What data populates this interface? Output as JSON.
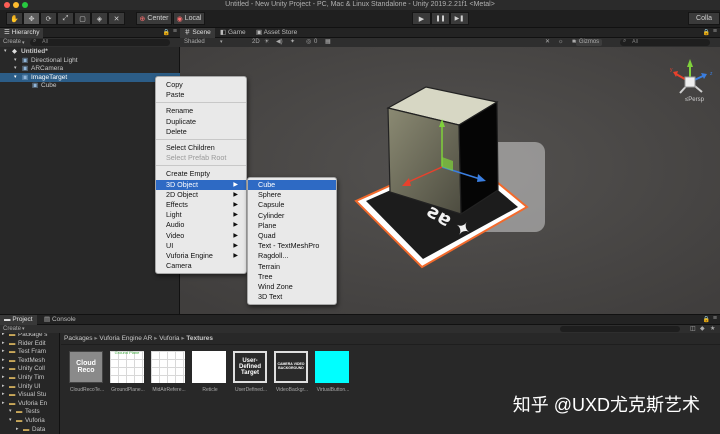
{
  "window": {
    "title": "Untitled - New Unity Project - PC, Mac & Linux Standalone - Unity 2019.2.21f1 <Metal>"
  },
  "toolbar": {
    "tools": [
      "hand-tool",
      "move-tool",
      "rotate-tool",
      "scale-tool",
      "rect-tool",
      "transform-tool",
      "custom-tool"
    ],
    "pivot_label": "Center",
    "space_label": "Local",
    "play_glyph": "▶",
    "pause_glyph": "❚❚",
    "step_glyph": "▶❚",
    "collab_label": "Colla"
  },
  "hierarchy": {
    "tab_label": "Hierarchy",
    "create_label": "Create",
    "search_placeholder": "All",
    "rows": [
      {
        "label": "Untitled*",
        "depth": 0,
        "selected": false
      },
      {
        "label": "Directional Light",
        "depth": 1,
        "selected": false
      },
      {
        "label": "ARCamera",
        "depth": 1,
        "selected": false
      },
      {
        "label": "ImageTarget",
        "depth": 1,
        "selected": true
      },
      {
        "label": "Cube",
        "depth": 2,
        "selected": false
      }
    ]
  },
  "scene_view": {
    "tabs": [
      "Scene",
      "Game",
      "Asset Store"
    ],
    "active_tab": "Scene",
    "shading_label": "Shaded",
    "mode_2d_label": "2D",
    "hidden_count": "0",
    "gizmos_label": "Gizmos",
    "search_placeholder": "All",
    "persp_label": "Persp"
  },
  "context_menu": {
    "items": [
      {
        "label": "Copy",
        "disabled": false,
        "submenu": false
      },
      {
        "label": "Paste",
        "disabled": false,
        "submenu": false
      },
      {
        "separator": true
      },
      {
        "label": "Rename",
        "disabled": false,
        "submenu": false
      },
      {
        "label": "Duplicate",
        "disabled": false,
        "submenu": false
      },
      {
        "label": "Delete",
        "disabled": false,
        "submenu": false
      },
      {
        "separator": true
      },
      {
        "label": "Select Children",
        "disabled": false,
        "submenu": false
      },
      {
        "label": "Select Prefab Root",
        "disabled": true,
        "submenu": false
      },
      {
        "separator": true
      },
      {
        "label": "Create Empty",
        "disabled": false,
        "submenu": false
      },
      {
        "label": "3D Object",
        "disabled": false,
        "submenu": true,
        "highlighted": true
      },
      {
        "label": "2D Object",
        "disabled": false,
        "submenu": true
      },
      {
        "label": "Effects",
        "disabled": false,
        "submenu": true
      },
      {
        "label": "Light",
        "disabled": false,
        "submenu": true
      },
      {
        "label": "Audio",
        "disabled": false,
        "submenu": true
      },
      {
        "label": "Video",
        "disabled": false,
        "submenu": true
      },
      {
        "label": "UI",
        "disabled": false,
        "submenu": true
      },
      {
        "label": "Vuforia Engine",
        "disabled": false,
        "submenu": true
      },
      {
        "label": "Camera",
        "disabled": false,
        "submenu": false
      }
    ]
  },
  "submenu_3d": {
    "items": [
      "Cube",
      "Sphere",
      "Capsule",
      "Cylinder",
      "Plane",
      "Quad",
      "Text - TextMeshPro",
      "Ragdoll...",
      "Terrain",
      "Tree",
      "Wind Zone",
      "3D Text"
    ],
    "highlighted": "Cube"
  },
  "project": {
    "tabs": [
      "Project",
      "Console"
    ],
    "active_tab": "Project",
    "create_label": "Create",
    "folders": [
      "Package s",
      "Rider Edit",
      "Test Fram",
      "TextMesh",
      "Unity Coll",
      "Unity Tim",
      "Unity UI",
      "Visual Stu",
      "Vuforia En",
      "Tests",
      "Vuforia",
      "Data"
    ],
    "breadcrumb": [
      "Packages",
      "Vuforia Engine AR",
      "Vuforia",
      "Textures"
    ],
    "assets": [
      {
        "name": "CloudRecoTe...",
        "thumb_text": "Cloud Reco",
        "style": "dark-gray",
        "thumb_color": "#8a8a8a"
      },
      {
        "name": "GroundPlane...",
        "thumb_text": "Ground Plane",
        "style": "grid-white",
        "thumb_color": "#ffffff"
      },
      {
        "name": "MidAirRefere...",
        "thumb_text": "",
        "style": "grid-white",
        "thumb_color": "#ffffff"
      },
      {
        "name": "Reticle",
        "thumb_text": "",
        "style": "white",
        "thumb_color": "#ffffff"
      },
      {
        "name": "UserDefined...",
        "thumb_text": "User-Defined Target",
        "style": "outlined",
        "thumb_color": "#2a2a2a"
      },
      {
        "name": "VideoBackgr...",
        "thumb_text": "CAMERA VIDEO BACKGROUND",
        "style": "outlined",
        "thumb_color": "#2a2a2a"
      },
      {
        "name": "VirtualButton...",
        "thumb_text": "",
        "style": "cyan",
        "thumb_color": "#00ffff"
      }
    ],
    "search_placeholder": ""
  },
  "watermark": "知乎 @UXD尤克斯艺术",
  "colors": {
    "selection": "#2c5d87",
    "menu_highlight": "#2e6ac4",
    "axis_x": "#e8412c",
    "axis_y": "#7fd13b",
    "axis_z": "#3a7ee0",
    "target_outline": "#f26a2c"
  }
}
